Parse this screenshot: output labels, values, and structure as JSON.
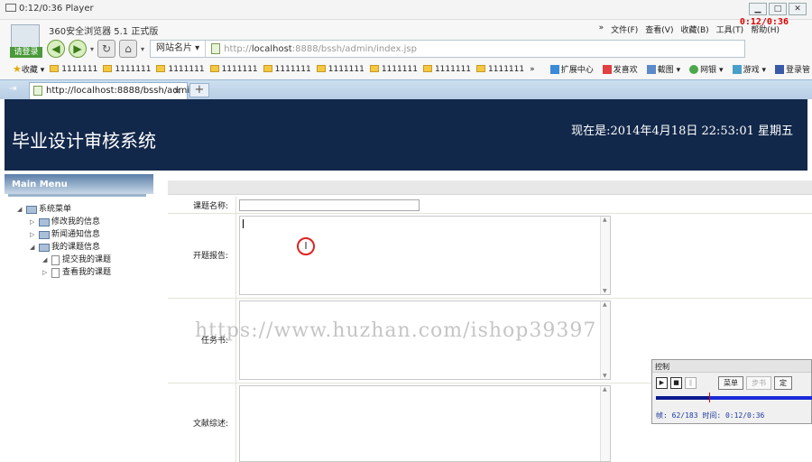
{
  "player": {
    "title": "0:12/0:36 Player",
    "rec_time": "0:12/0:36"
  },
  "browser": {
    "title": "360安全浏览器 5.1 正式版",
    "login_label": "请登录",
    "menu": [
      "文件(F)",
      "查看(V)",
      "收藏(B)",
      "工具(T)",
      "帮助(H)"
    ],
    "site_names": "网站名片",
    "url_prefix": "http://",
    "url_host": "localhost",
    "url_rest": ":8888/bssh/admin/index.jsp",
    "favorites_label": "收藏",
    "favorites": [
      "1111111",
      "1111111",
      "1111111",
      "1111111",
      "1111111",
      "1111111",
      "1111111",
      "1111111",
      "1111111"
    ],
    "fav_more": "»",
    "toolbar_right": [
      "扩展中心",
      "发喜欢",
      "截图",
      "网银",
      "游戏",
      "登录管"
    ],
    "tab_title": "http://localhost:8888/bssh/admi...",
    "tab_close": "×",
    "new_tab": "+"
  },
  "header": {
    "system_name": "毕业设计审核系统",
    "now_text": "现在是:2014年4月18日  22:53:01 星期五"
  },
  "sidebar": {
    "title": "Main Menu",
    "tree": [
      {
        "label": "系统菜单",
        "level": 0,
        "type": "folder",
        "expanded": true
      },
      {
        "label": "修改我的信息",
        "level": 1,
        "type": "folder",
        "expanded": false
      },
      {
        "label": "新闻通知信息",
        "level": 1,
        "type": "folder",
        "expanded": false
      },
      {
        "label": "我的课题信息",
        "level": 1,
        "type": "folder",
        "expanded": true
      },
      {
        "label": "提交我的课题",
        "level": 2,
        "type": "page",
        "expanded": true
      },
      {
        "label": "查看我的课题",
        "level": 2,
        "type": "page",
        "expanded": false
      }
    ]
  },
  "form": {
    "topic_label": "课题名称:",
    "topic_value": "",
    "proposal_label": "开题报告:",
    "task_label": "任务书:",
    "review_label": "文献综述:"
  },
  "watermark": "https://www.huzhan.com/ishop39397",
  "control": {
    "title": "控制",
    "menu_button": "菜单",
    "step_button": "步书",
    "more_button": "定",
    "status": "帧: 62/183 时间: 0:12/0:36",
    "progress": 0.339
  }
}
